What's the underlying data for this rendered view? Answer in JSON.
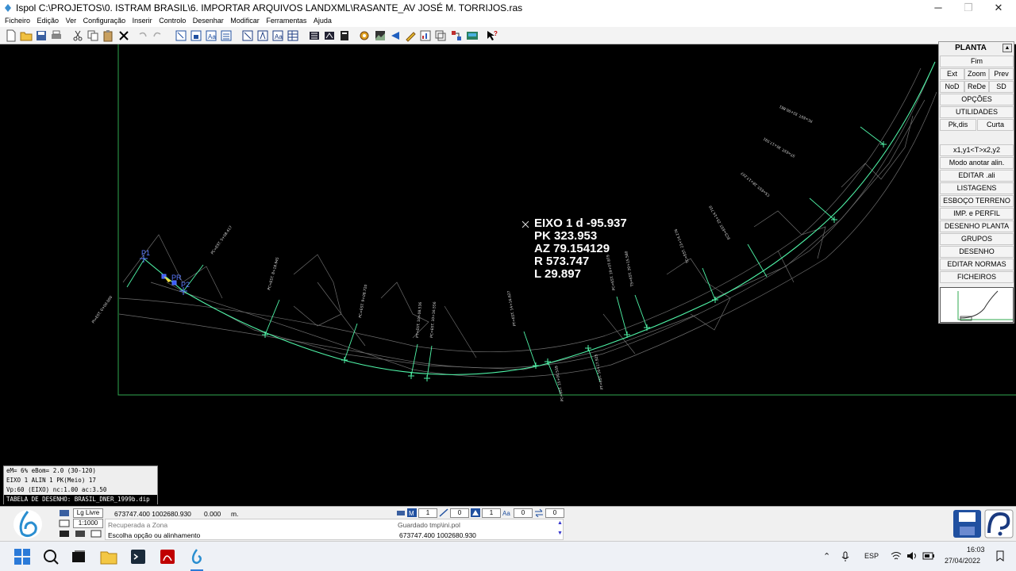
{
  "window": {
    "app_name": "Ispol",
    "title_path": "C:\\PROJETOS\\0. ISTRAM BRASIL\\6. IMPORTAR ARQUIVOS LANDXML\\RASANTE_AV JOSÉ M. TORRIJOS.ras"
  },
  "menu": [
    "Ficheiro",
    "Edição",
    "Ver",
    "Configuração",
    "Inserir",
    "Controlo",
    "Desenhar",
    "Modificar",
    "Ferramentas",
    "Ajuda"
  ],
  "info": {
    "line1": "EIXO 1 d -95.937",
    "line2": "PK  323.953",
    "line3": "AZ  79.154129",
    "line4": "R 573.747",
    "line5": "L  29.897"
  },
  "left_info": {
    "line1": "eM= 6% eBom= 2.0 (30-120)",
    "line2": "EIXO 1 ALIN 1 PK(Meio) 17",
    "line3": "Vp:60 (EIXO) nc:1.00 ac:3.50",
    "line4": "TABELA DE DESENHO: BRASIL_DNER_1999b.dip"
  },
  "plot_labels": {
    "p1": "P1",
    "pr": "PR",
    "p2": "P2"
  },
  "panel": {
    "title": "PLANTA",
    "fim": "Fim",
    "ext": "Ext",
    "zoom": "Zoom",
    "prev": "Prev",
    "nod": "NoD",
    "rede": "ReDe",
    "sd": "SD",
    "opcoes": "OPÇÕES",
    "utilidades": "UTILIDADES",
    "pkdis": "Pk,dis",
    "curta": "Curta",
    "x1y1": "x1,y1<T>x2,y2",
    "modo": "Modo anotar alin.",
    "editar_ali": "EDITAR .ali",
    "listagens": "LISTAGENS",
    "esboco": "ESBOÇO TERRENO",
    "imp_perfil": "IMP. e PERFIL",
    "desenho_planta": "DESENHO PLANTA",
    "grupos": "GRUPOS",
    "desenho": "DESENHO",
    "editar_normas": "EDITAR NORMAS",
    "ficheiros": "FICHEIROS"
  },
  "status": {
    "lig_livre": "Lg Livre",
    "scale": "1:1000",
    "coords": "673747.400  1002680.930",
    "z": "0.000",
    "unit": "m.",
    "msg1": "Recuperada a Zona",
    "msg2": "Escolha opção ou alinhamento",
    "msg3": "Guardado tmp\\ini.pol",
    "msg4": "673747.400  1002680.930",
    "field1": "1",
    "field2": "0",
    "field3": "1",
    "field4": "0",
    "field5": "0"
  },
  "taskbar": {
    "lang": "ESP",
    "time": "16:03",
    "date": "27/04/2022"
  },
  "colors": {
    "axis": "#4ff5a8",
    "frame": "#2fa84f",
    "terrain": "#7a7a7a"
  }
}
